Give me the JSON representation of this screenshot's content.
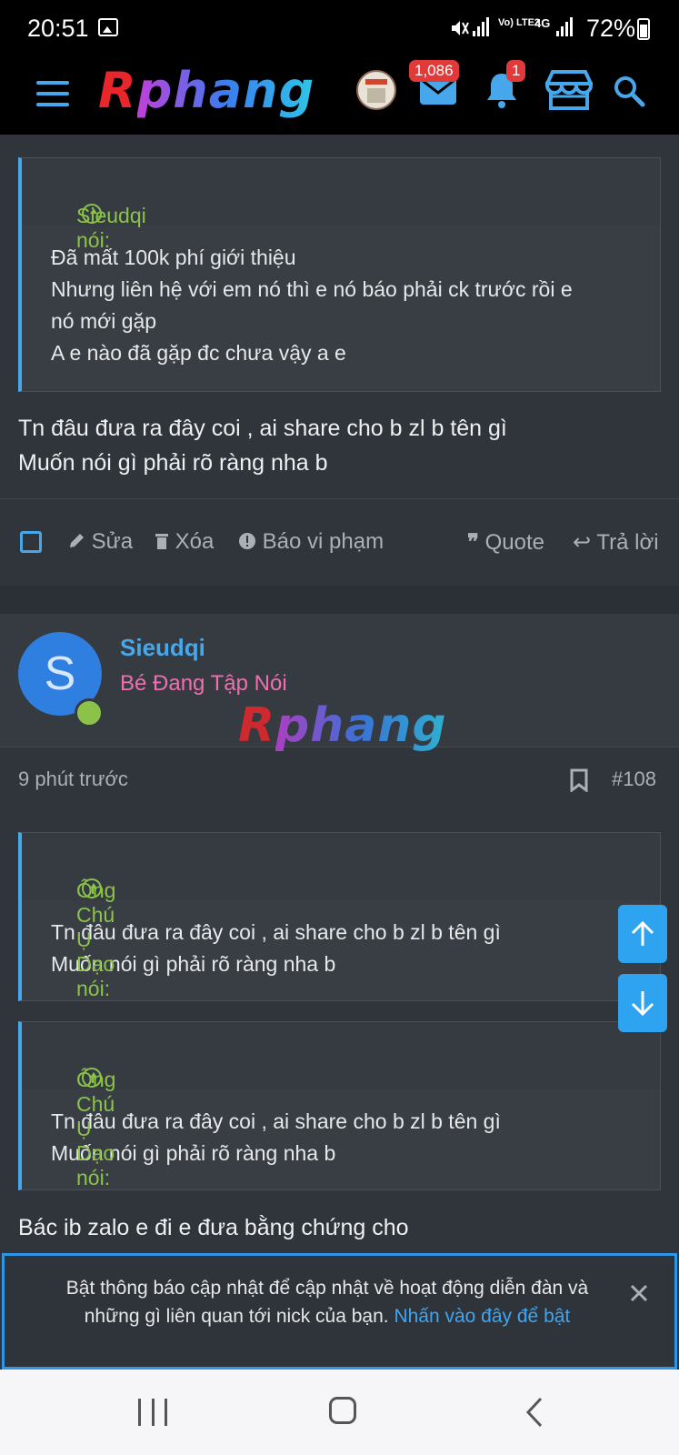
{
  "status_bar": {
    "time": "20:51",
    "network": "4G",
    "volte": "Vo) LTE2",
    "battery": "72%"
  },
  "header": {
    "logo_r": "R",
    "logo_rest": "phang",
    "messages_badge": "1,086",
    "alerts_badge": "1",
    "icons": [
      "menu-icon",
      "mail-icon",
      "bell-icon",
      "store-icon",
      "search-icon"
    ]
  },
  "post1": {
    "quote_author": "Sieudqi nói:",
    "quote_lines": [
      "Đã mất 100k phí giới thiệu",
      "Nhưng liên hệ với em nó thì e nó báo phải ck trước rồi e",
      "nó mới gặp",
      "A e nào đã gặp đc chưa vậy a e"
    ],
    "body_lines": [
      "Tn đâu đưa ra đây coi , ai share cho b zl b tên gì",
      "Muốn nói gì phải rõ ràng nha b"
    ],
    "actions": {
      "edit": "Sửa",
      "delete": "Xóa",
      "report": "Báo vi phạm",
      "quote": "Quote",
      "reply": "Trả lời"
    }
  },
  "post2": {
    "avatar_letter": "S",
    "username": "Sieudqi",
    "user_title": "Bé Đang Tập Nói",
    "time": "9 phút trước",
    "post_number": "#108",
    "quote1_author": "Ông Chú Ụ Dạo nói:",
    "quote1_lines": [
      "Tn đâu đưa ra đây coi , ai share cho b zl b tên gì",
      "Muốn nói gì phải rõ ràng nha b"
    ],
    "quote2_author": "Ông Chú Ụ Dạo nói:",
    "quote2_lines": [
      "Tn đâu đưa ra đây coi , ai share cho b zl b tên gì",
      "Muốn nói gì phải rõ ràng nha b"
    ],
    "body": "Bác ib zalo e đi e đưa bằng chứng cho"
  },
  "notification": {
    "text": "Bật thông báo cập nhật để cập nhật về hoạt động diễn đàn và những gì liên quan tới nick của bạn.",
    "link": "Nhấn vào đây để bật"
  },
  "colors": {
    "accent": "#47a7eb",
    "quote_author": "#8bc34a",
    "user_title": "#f06fb0",
    "badge": "#e03a3a"
  }
}
